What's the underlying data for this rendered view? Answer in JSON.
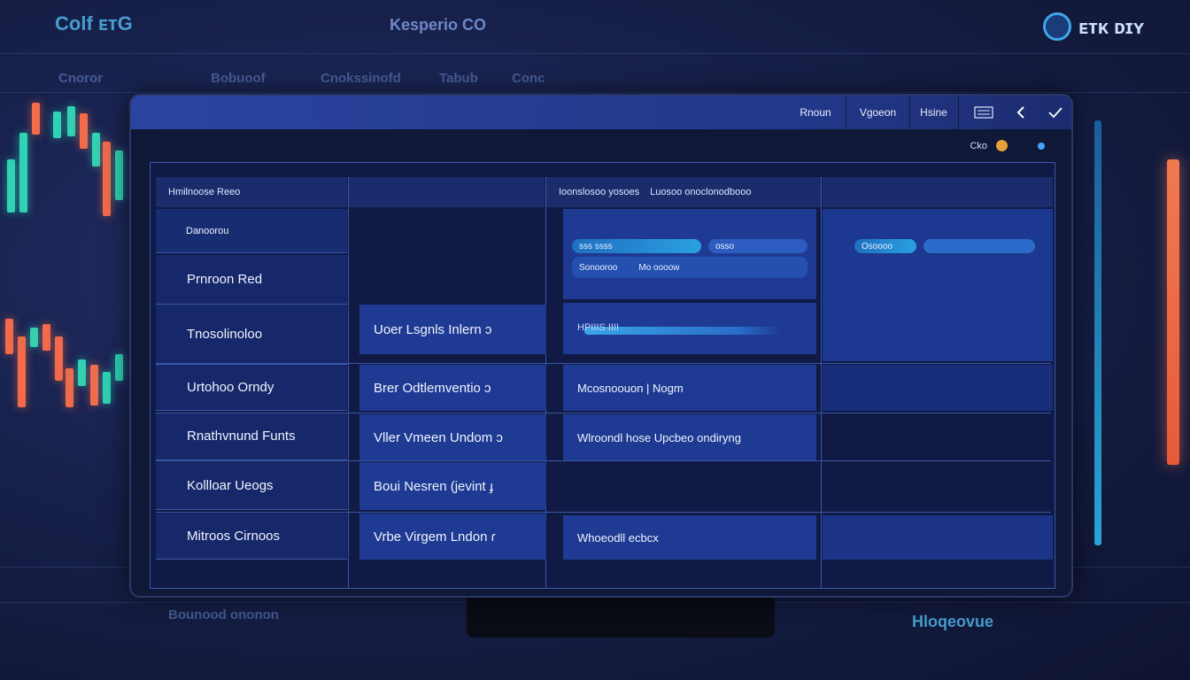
{
  "background": {
    "top_left_title": "Cоlf ᴇᴛG",
    "top_center_title": "Kesperio CO",
    "brand": "ᴇᴛᴋ ᴅɪʏ",
    "menu_items": [
      "Cnoror",
      "Bobuoof",
      "Cnokssinofd",
      "Tabub",
      "Conc"
    ],
    "bottom_ticker_left": "Bounood ononon",
    "bottom_ticker_right": "Hloqeovue"
  },
  "titlebar": {
    "tabs": [
      "Rnoun",
      "Vgoeon",
      "Hsine"
    ],
    "check_icon": "check-icon",
    "back_icon": "chevron-left-icon",
    "grid_icon": "grid-icon"
  },
  "subbar": {
    "label": "Cko"
  },
  "panel": {
    "header_left": "Hmilnoose Reeo",
    "header_right_a": "Ioonslosoo yosoes",
    "header_right_b": "Luosoo onoclonodbooo",
    "col_a_subheader": "Danoorou",
    "col_a": [
      "Prnroon Red",
      "Tnosolinoloo",
      "Urtohoo Orndy",
      "Rnathvnund Funts",
      "Kollloar Ueogs",
      "Mitroos Cirnoos"
    ],
    "col_b": [
      "Uoer  Lsgnls  Inlern  ɔ",
      "Brer  Odtlemventio  ɔ",
      "Vller  Vmeen  Undom  ɔ",
      "Boui  Nesren  (jevint  ɟ",
      "Vrbe  Virgem  Lndon  ɾ"
    ],
    "col_c": {
      "pills": [
        "sss  ssss",
        "osso",
        "sso"
      ],
      "sub_labels": [
        "Sonooroo",
        "Mo oooow"
      ],
      "progress_label": "HPIIIS IIII",
      "progress": 0.85,
      "rows": [
        "Mcosnoouon  |  Nogm",
        "Wlroondl hose  Upcbeo ondiryng",
        "Whoeodll ecbcx"
      ]
    },
    "col_d": {
      "pills": [
        "Osoooo",
        ""
      ]
    }
  },
  "colors": {
    "accent": "#2aa0e0",
    "candle_up": "#2fd3b4",
    "candle_down": "#f26b4a"
  }
}
